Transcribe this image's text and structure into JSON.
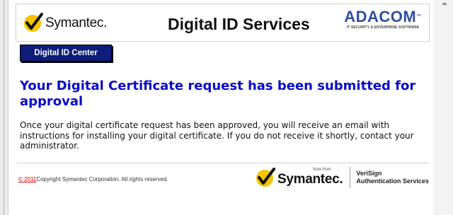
{
  "header": {
    "brand_name": "Symantec.",
    "title": "Digital ID Services",
    "partner_name": "ADACOM",
    "partner_tagline": "IT SECURITY & ENTERPRISE SOFTWARE",
    "partner_tm": "™"
  },
  "nav": {
    "id_center_label": "Digital ID Center"
  },
  "main": {
    "heading": "Your Digital Certificate request has been submitted for approval",
    "message": "Once your digital certificate request has been approved, you will receive an email with instructions for installing your digital certificate. If you do not receive it shortly, contact your administrator."
  },
  "footer": {
    "copyright_link": "© 2011",
    "copyright_text": "Copyright Symantec Corporation. All rights reserved.",
    "now_from": "Now from",
    "brand_name": "Symantec.",
    "verisign_line1": "VeriSign",
    "verisign_line2": "Authentication Services"
  },
  "colors": {
    "heading": "#0a0ac8",
    "nav_button": "#0e1c7a",
    "partner_blue": "#2d4ea0",
    "check_yellow": "#f5c400",
    "link_red": "#cc0000"
  },
  "icons": {
    "brand_logo": "checkmark-icon",
    "scroll_up": "chevron-up-icon"
  }
}
